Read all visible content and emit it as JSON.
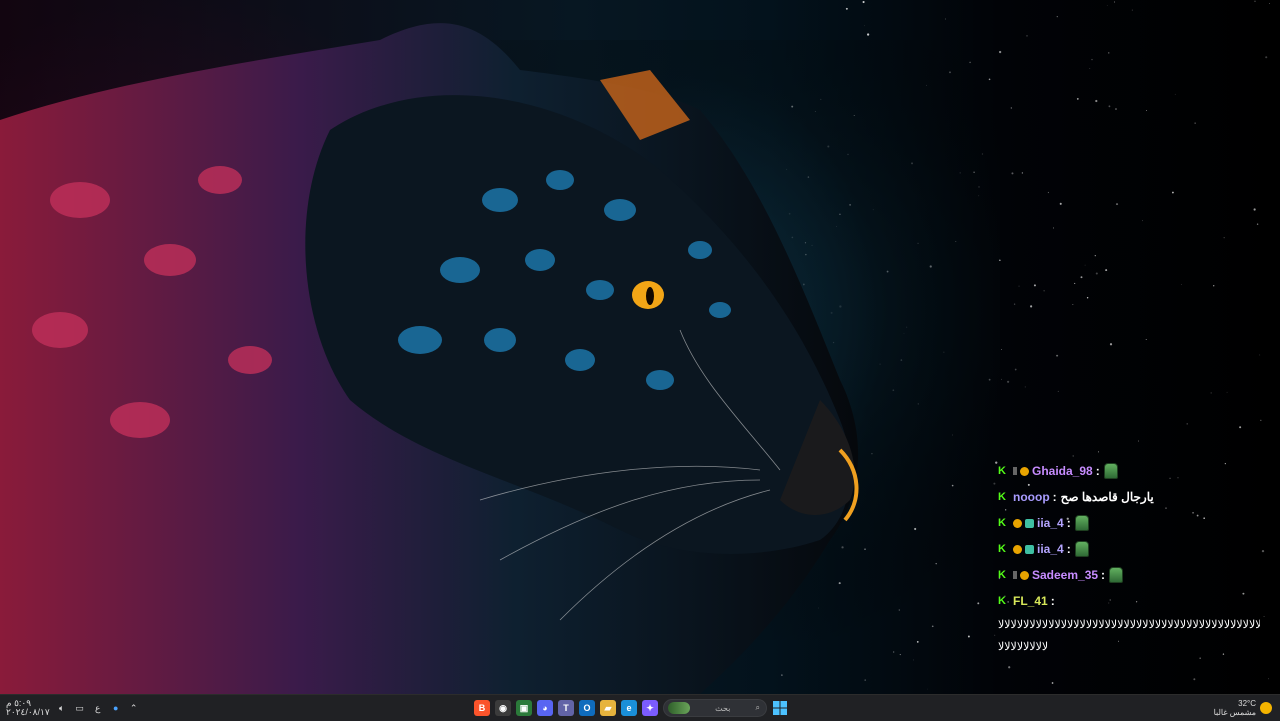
{
  "chat": {
    "messages": [
      {
        "user": "Ghaida_98",
        "user_color": "#c78cff",
        "badges": [
          "kick",
          "dim",
          "sub"
        ],
        "text": "",
        "emote": true
      },
      {
        "user": "nooop",
        "user_color": "#a99cff",
        "badges": [
          "kick"
        ],
        "text": "يارجال قاصدها صح",
        "emote": false
      },
      {
        "user": "iia_4",
        "user_color": "#b4a4ff",
        "badges": [
          "kick",
          "sub",
          "gift"
        ],
        "text": "",
        "emote": true
      },
      {
        "user": "iia_4",
        "user_color": "#b4a4ff",
        "badges": [
          "kick",
          "sub",
          "gift"
        ],
        "text": "",
        "emote": true
      },
      {
        "user": "Sadeem_35",
        "user_color": "#c78cff",
        "badges": [
          "kick",
          "dim",
          "sub"
        ],
        "text": "",
        "emote": true
      },
      {
        "user": "FL_41",
        "user_color": "#d8e85a",
        "badges": [
          "kick"
        ],
        "text": "",
        "emote": false
      }
    ],
    "long_line_1": "ﻻﻻﻻﻻﻻﻻﻻﻻﻻﻻﻻﻻﻻﻻﻻﻻﻻﻻﻻﻻﻻﻻﻻﻻﻻﻻﻻﻻﻻﻻﻻﻻﻻﻻﻻﻻﻻﻻﻻﻻﻻﻻﻻﻻﻻﻻ",
    "long_line_2": "ﻻﻻﻻﻻﻻﻻﻻﻻ"
  },
  "taskbar": {
    "clock_time": "٥:٠٩ م",
    "clock_date": "٢٠٢٤/٠٨/١٧",
    "language": "ع",
    "search_placeholder": "بحث",
    "apps": [
      {
        "icon": "brave-icon",
        "glyph": "B",
        "color": "#fb542b"
      },
      {
        "icon": "obs-icon",
        "glyph": "◉",
        "color": "#3b3b3b"
      },
      {
        "icon": "xbox-icon",
        "glyph": "▣",
        "color": "#2b7a3a"
      },
      {
        "icon": "discord-icon",
        "glyph": "◕",
        "color": "#5865f2"
      },
      {
        "icon": "teams-icon",
        "glyph": "T",
        "color": "#6264a7"
      },
      {
        "icon": "outlook-icon",
        "glyph": "O",
        "color": "#0f6cbd"
      },
      {
        "icon": "file-explorer-icon",
        "glyph": "▰",
        "color": "#e6b33d"
      },
      {
        "icon": "edge-icon",
        "glyph": "e",
        "color": "#1a8fd8"
      },
      {
        "icon": "copilot-icon",
        "glyph": "✦",
        "color": "#7b5cff"
      }
    ],
    "weather_temp": "32°C",
    "weather_desc": "مشمس غالبا"
  }
}
